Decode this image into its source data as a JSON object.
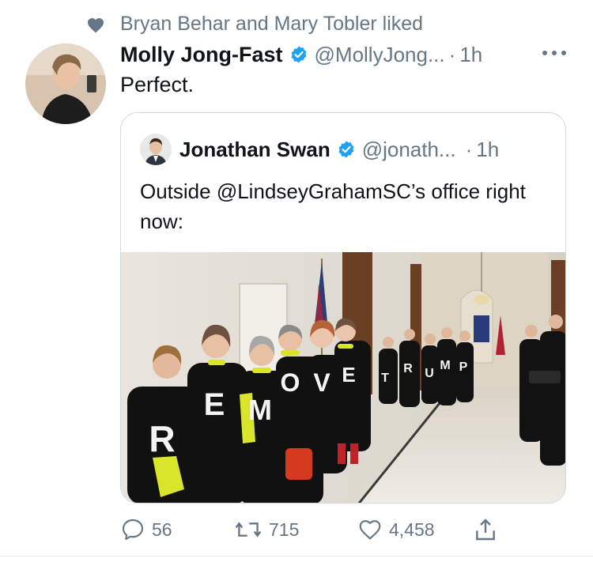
{
  "social_context": {
    "text": "Bryan Behar and Mary Tobler liked",
    "icon": "heart-icon"
  },
  "tweet": {
    "author_name": "Molly Jong-Fast",
    "handle": "@MollyJong...",
    "separator": "·",
    "time": "1h",
    "text": "Perfect.",
    "verified_color": "#1da1f2"
  },
  "quoted_tweet": {
    "author_name": "Jonathan Swan",
    "handle": "@jonath...",
    "separator": "·",
    "time": "1h",
    "text": "Outside @LindseyGrahamSC’s office right now:",
    "photo_letters": [
      "R",
      "E",
      "M",
      "O",
      "V",
      "E",
      "T",
      "R",
      "U",
      "M",
      "P"
    ]
  },
  "actions": {
    "replies": "56",
    "retweets": "715",
    "likes": "4,458",
    "share_icon": "share-icon"
  }
}
